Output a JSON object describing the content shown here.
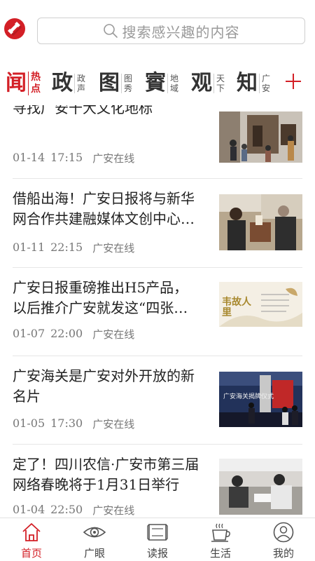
{
  "search": {
    "placeholder": "搜索感兴趣的内容"
  },
  "tabs": [
    {
      "big": "闻",
      "sub1": "热",
      "sub2": "点",
      "active": true
    },
    {
      "big": "政",
      "sub1": "政",
      "sub2": "声",
      "active": false
    },
    {
      "big": "图",
      "sub1": "图",
      "sub2": "秀",
      "active": false
    },
    {
      "big": "賨",
      "sub1": "地",
      "sub2": "域",
      "active": false
    },
    {
      "big": "观",
      "sub1": "天",
      "sub2": "下",
      "active": false
    },
    {
      "big": "知",
      "sub1": "广",
      "sub2": "安",
      "active": false
    }
  ],
  "articles": [
    {
      "title": "寻找广安十大文化地标",
      "date": "01-14",
      "time": "17:15",
      "source": "广安在线"
    },
    {
      "title": "借船出海！广安日报将与新华网合作共建融媒体文创中心…",
      "date": "01-11",
      "time": "22:15",
      "source": "广安在线"
    },
    {
      "title": "广安日报重磅推出H5产品，以后推介广安就发这“四张…",
      "date": "01-07",
      "time": "22:00",
      "source": "广安在线",
      "thumb_text": "韦故人里"
    },
    {
      "title": "广安海关是广安对外开放的新名片",
      "date": "01-05",
      "time": "17:30",
      "source": "广安在线",
      "thumb_text": "广安海关揭牌仪式"
    },
    {
      "title": "定了！四川农信·广安市第三届网络春晚将于1月31日举行",
      "date": "01-04",
      "time": "22:50",
      "source": "广安在线"
    }
  ],
  "bottom_nav": [
    {
      "label": "首页",
      "icon": "home-icon",
      "active": true
    },
    {
      "label": "广眼",
      "icon": "eye-icon",
      "active": false
    },
    {
      "label": "读报",
      "icon": "newspaper-icon",
      "active": false
    },
    {
      "label": "生活",
      "icon": "coffee-icon",
      "active": false
    },
    {
      "label": "我的",
      "icon": "user-icon",
      "active": false
    }
  ],
  "colors": {
    "accent": "#d31f26",
    "divider": "#e6e6e6",
    "meta": "#777777"
  }
}
